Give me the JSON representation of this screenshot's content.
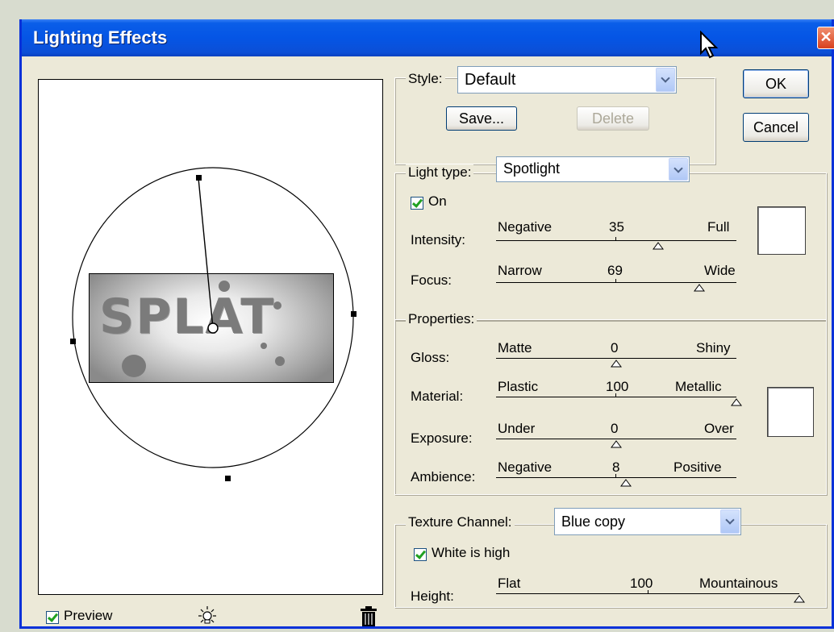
{
  "window": {
    "title": "Lighting Effects"
  },
  "buttons": {
    "ok": "OK",
    "cancel": "Cancel",
    "save": "Save...",
    "delete": "Delete"
  },
  "style": {
    "label": "Style:",
    "value": "Default"
  },
  "light": {
    "type_label": "Light type:",
    "type_value": "Spotlight",
    "on_label": "On",
    "intensity": {
      "label": "Intensity:",
      "left": "Negative",
      "value": "35",
      "right": "Full",
      "level": 0.675
    },
    "focus": {
      "label": "Focus:",
      "left": "Narrow",
      "value": "69",
      "right": "Wide",
      "level": 0.845
    }
  },
  "properties": {
    "title": "Properties:",
    "gloss": {
      "label": "Gloss:",
      "left": "Matte",
      "value": "0",
      "right": "Shiny",
      "level": 0.5
    },
    "material": {
      "label": "Material:",
      "left": "Plastic",
      "value": "100",
      "right": "Metallic",
      "level": 1.0
    },
    "exposure": {
      "label": "Exposure:",
      "left": "Under",
      "value": "0",
      "right": "Over",
      "level": 0.5
    },
    "ambience": {
      "label": "Ambience:",
      "left": "Negative",
      "value": "8",
      "right": "Positive",
      "level": 0.54
    }
  },
  "texture": {
    "channel_label": "Texture Channel:",
    "channel_value": "Blue copy",
    "white_high_label": "White is high",
    "height": {
      "label": "Height:",
      "left": "Flat",
      "value": "100",
      "right": "Mountainous",
      "level": 1.0
    }
  },
  "preview": {
    "label": "Preview",
    "image_text": "SPLAT"
  },
  "icons": {
    "light_bulb": "light-bulb-icon",
    "trash": "trash-icon",
    "close": "close-icon",
    "cursor": "cursor-icon"
  }
}
